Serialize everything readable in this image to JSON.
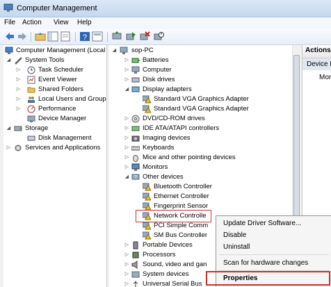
{
  "window": {
    "title": "Computer Management"
  },
  "menu": [
    "File",
    "Action",
    "View",
    "Help"
  ],
  "left_tree": [
    {
      "label": "Computer Management (Local",
      "icon": "computer-management-icon"
    },
    {
      "label": "System Tools",
      "icon": "tools-icon"
    },
    {
      "label": "Task Scheduler",
      "icon": "clock-icon"
    },
    {
      "label": "Event Viewer",
      "icon": "event-viewer-icon"
    },
    {
      "label": "Shared Folders",
      "icon": "folder-icon"
    },
    {
      "label": "Local Users and Groups",
      "icon": "users-icon"
    },
    {
      "label": "Performance",
      "icon": "performance-icon"
    },
    {
      "label": "Device Manager",
      "icon": "device-manager-icon"
    },
    {
      "label": "Storage",
      "icon": "storage-icon"
    },
    {
      "label": "Disk Management",
      "icon": "disk-icon"
    },
    {
      "label": "Services and Applications",
      "icon": "services-icon"
    }
  ],
  "device_tree": [
    {
      "label": "sop-PC"
    },
    {
      "label": "Batteries"
    },
    {
      "label": "Computer"
    },
    {
      "label": "Disk drives"
    },
    {
      "label": "Display adapters"
    },
    {
      "label": "Standard VGA Graphics Adapter"
    },
    {
      "label": "Standard VGA Graphics Adapter"
    },
    {
      "label": "DVD/CD-ROM drives"
    },
    {
      "label": "IDE ATA/ATAPI controllers"
    },
    {
      "label": "Imaging devices"
    },
    {
      "label": "Keyboards"
    },
    {
      "label": "Mice and other pointing devices"
    },
    {
      "label": "Monitors"
    },
    {
      "label": "Other devices"
    },
    {
      "label": "Bluetooth Controller"
    },
    {
      "label": "Ethernet Controller"
    },
    {
      "label": "Fingerprint Sensor"
    },
    {
      "label": "Network Controlle"
    },
    {
      "label": "PCI Simple Comm"
    },
    {
      "label": "SM Bus Controller"
    },
    {
      "label": "Portable Devices"
    },
    {
      "label": "Processors"
    },
    {
      "label": "Sound, video and gan"
    },
    {
      "label": "System devices"
    },
    {
      "label": "Universal Serial Bus"
    }
  ],
  "actions": {
    "header": "Actions",
    "section": "Device M",
    "more": "Mor"
  },
  "context_menu": {
    "update": "Update Driver Software...",
    "disable": "Disable",
    "uninstall": "Uninstall",
    "scan": "Scan for hardware changes",
    "properties": "Properties"
  },
  "colors": {
    "highlight_box": "#c9302c",
    "warning": "#f0c020"
  }
}
